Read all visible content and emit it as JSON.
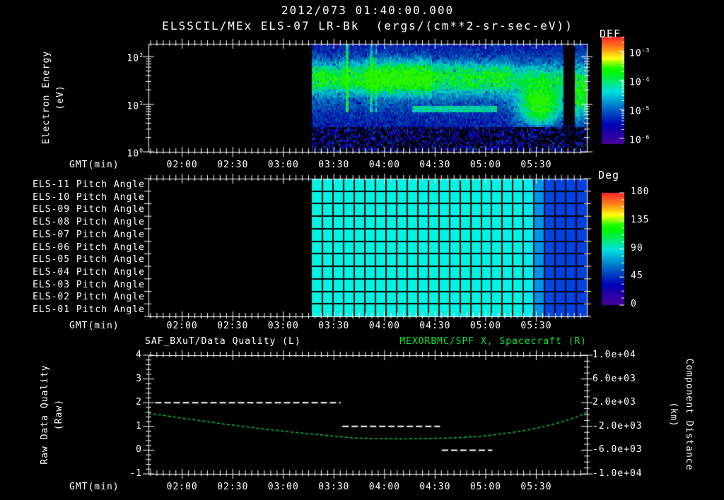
{
  "header": {
    "datetime": "2012/073 01:40:00.000",
    "title": "ELSSCIL/MEx ELS-07 LR-Bk  (ergs/(cm**2-sr-sec-eV))"
  },
  "time_axis": {
    "axis_label": "GMT(min)",
    "labels": [
      "02:00",
      "02:30",
      "03:00",
      "03:30",
      "04:00",
      "04:30",
      "05:00",
      "05:30"
    ],
    "start": "01:40",
    "end": "06:00"
  },
  "panel1": {
    "ylabel_line1": "Electron Energy",
    "ylabel_line2": "(eV)",
    "ytick_labels": [
      "10^2",
      "10^1",
      "10^0"
    ],
    "colorbar_title": "DEF",
    "colorbar_tick_labels": [
      "10^-3",
      "10^-4",
      "10^-5",
      "10^-6"
    ]
  },
  "panel2": {
    "colorbar_title": "Deg",
    "colorbar_tick_labels": [
      "180",
      "135",
      "90",
      "45",
      "0"
    ],
    "row_labels": [
      "ELS-11 Pitch Angle",
      "ELS-10 Pitch Angle",
      "ELS-09 Pitch Angle",
      "ELS-08 Pitch Angle",
      "ELS-07 Pitch Angle",
      "ELS-06 Pitch Angle",
      "ELS-05 Pitch Angle",
      "ELS-04 Pitch Angle",
      "ELS-03 Pitch Angle",
      "ELS-02 Pitch Angle",
      "ELS-01 Pitch Angle"
    ]
  },
  "panel3": {
    "title_left": "SAF_BXuT/Data Quality (L)",
    "title_right": "MEXORBMC/SPF X, Spacecraft (R)",
    "ylabel_left_1": "Raw Data Quality",
    "ylabel_left_2": "(Raw)",
    "ytick_labels_left": [
      "4",
      "3",
      "2",
      "1",
      "0",
      "-1"
    ],
    "ylabel_right_1": "Component Distance",
    "ylabel_right_2": "(km)",
    "ytick_labels_right": [
      "1.0e+04",
      "6.0e+03",
      "2.0e+03",
      "-2.0e+03",
      "-6.0e+03",
      "-1.0e+04"
    ]
  },
  "colors": {
    "background": "#000000",
    "foreground": "#ffffff",
    "green_accent": "#00e62e",
    "curve_green": "#00cc44",
    "white_series": "#ffffff"
  },
  "chart_data": [
    {
      "id": "electron_energy_spectrogram",
      "type": "heatmap",
      "title": "ELSSCIL/MEx ELS-07 LR-Bk",
      "units": "ergs/(cm**2-sr-sec-eV)",
      "x_axis": {
        "label": "GMT(min)",
        "start": "01:40",
        "end": "06:00",
        "tick_labels": [
          "02:00",
          "02:30",
          "03:00",
          "03:30",
          "04:00",
          "04:30",
          "05:00",
          "05:30"
        ]
      },
      "y_axis": {
        "label": "Electron Energy (eV)",
        "scale": "log",
        "min": 1,
        "max": 186,
        "tick_labels": [
          "10^2",
          "10^1",
          "10^0"
        ]
      },
      "colorbar": {
        "title": "DEF",
        "tick_labels": [
          "10^-3",
          "10^-4",
          "10^-5",
          "10^-6"
        ],
        "top_exponent": -2.5,
        "bottom_exponent": -6.2
      },
      "model": {
        "data_start_min": 97,
        "data_end_min": 260,
        "gap_min": [
          246,
          252.5
        ],
        "main_band": {
          "log10_center": 1.58,
          "sigma": 0.23,
          "envelope": [
            [
              97,
              0.42
            ],
            [
              128,
              0.62
            ],
            [
              168,
              0.4
            ],
            [
              215,
              0.26
            ],
            [
              246,
              0.38
            ]
          ]
        },
        "low_band": {
          "log10_center": 0.92,
          "sigma": 0.08,
          "t_range": [
            156,
            206
          ],
          "level": 0.5
        },
        "blob": {
          "t_center": 232,
          "t_sigma": 9,
          "log10_center": 0.98,
          "sigma": 0.3,
          "level": 0.5
        },
        "streaks_until_min": 135,
        "dark_zone_log10_below": 0.52
      },
      "features": [
        "no data before ~03:18",
        "broad 10-60 eV flux band ~1e-4 from 03:18 to 05:45",
        "brightest green interval 03:48-04:25",
        "thin cyan band near 8 eV from 04:15-05:05",
        "green blob 4-20 eV at 05:20-05:45",
        "black data gap 05:46-05:52",
        "dark speckled background below ~3 eV"
      ]
    },
    {
      "id": "pitch_angle_heatmap",
      "type": "heatmap",
      "x_axis": {
        "label": "GMT(min)",
        "start": "01:40",
        "end": "06:00",
        "tick_labels": [
          "02:00",
          "02:30",
          "03:00",
          "03:30",
          "04:00",
          "04:30",
          "05:00",
          "05:30"
        ]
      },
      "colorbar": {
        "title": "Deg",
        "min": 0,
        "max": 180,
        "tick_labels": [
          "180",
          "135",
          "90",
          "45",
          "0"
        ]
      },
      "data_start_min": 97,
      "data_end_min": 260,
      "transition_start_min": 222,
      "transition_end_min": 240,
      "grid_columns": 26,
      "rows": [
        {
          "label": "ELS-11 Pitch Angle",
          "deg_start": 112,
          "deg_end": 118
        },
        {
          "label": "ELS-10 Pitch Angle",
          "deg_start": 110,
          "deg_end": 116
        },
        {
          "label": "ELS-09 Pitch Angle",
          "deg_start": 108,
          "deg_end": 114
        },
        {
          "label": "ELS-08 Pitch Angle",
          "deg_start": 106,
          "deg_end": 111
        },
        {
          "label": "ELS-07 Pitch Angle",
          "deg_start": 103,
          "deg_end": 107
        },
        {
          "label": "ELS-06 Pitch Angle",
          "deg_start": 100,
          "deg_end": 101
        },
        {
          "label": "ELS-05 Pitch Angle",
          "deg_start": 97,
          "deg_end": 86
        },
        {
          "label": "ELS-04 Pitch Angle",
          "deg_start": 95,
          "deg_end": 60
        },
        {
          "label": "ELS-03 Pitch Angle",
          "deg_start": 93,
          "deg_end": 53
        },
        {
          "label": "ELS-02 Pitch Angle",
          "deg_start": 92,
          "deg_end": 50
        },
        {
          "label": "ELS-01 Pitch Angle",
          "deg_start": 91,
          "deg_end": 48
        }
      ]
    },
    {
      "id": "quality_distance_plot",
      "type": "line",
      "x_axis": {
        "label": "GMT(min)",
        "start": "01:40",
        "end": "06:00",
        "tick_labels": [
          "02:00",
          "02:30",
          "03:00",
          "03:30",
          "04:00",
          "04:30",
          "05:00",
          "05:30"
        ]
      },
      "left_axis": {
        "label": "Raw Data Quality (Raw)",
        "min": -1,
        "max": 4,
        "ticks": [
          4,
          3,
          2,
          1,
          0,
          -1
        ]
      },
      "right_axis": {
        "label": "Component Distance (km)",
        "min": -10000,
        "max": 10000,
        "tick_labels": [
          "1.0e+04",
          "6.0e+03",
          "2.0e+03",
          "-2.0e+03",
          "-6.0e+03",
          "-1.0e+04"
        ]
      },
      "series": [
        {
          "name": "SAF_BXuT/Data Quality (L)",
          "axis": "left",
          "color": "#ffffff",
          "style": "dashed",
          "segments": [
            {
              "t_min": [
                4,
                114
              ],
              "value": 2
            },
            {
              "t_min": [
                115,
                173
              ],
              "value": 1
            },
            {
              "t_min": [
                174,
                204
              ],
              "value": 0
            }
          ]
        },
        {
          "name": "MEXORBMC/SPF X, Spacecraft (R)",
          "axis": "right",
          "color": "#00cc44",
          "style": "dashed",
          "points_min_km": [
            [
              0,
              200
            ],
            [
              15,
              -400
            ],
            [
              30,
              -1000
            ],
            [
              45,
              -1600
            ],
            [
              60,
              -2150
            ],
            [
              75,
              -2650
            ],
            [
              90,
              -3100
            ],
            [
              105,
              -3500
            ],
            [
              122,
              -3950
            ],
            [
              135,
              -4050
            ],
            [
              150,
              -4100
            ],
            [
              165,
              -4050
            ],
            [
              180,
              -3950
            ],
            [
              195,
              -3700
            ],
            [
              205,
              -3400
            ],
            [
              215,
              -3050
            ],
            [
              225,
              -2600
            ],
            [
              235,
              -2000
            ],
            [
              243,
              -1400
            ],
            [
              250,
              -800
            ],
            [
              256,
              -200
            ],
            [
              260,
              400
            ]
          ]
        }
      ]
    }
  ]
}
